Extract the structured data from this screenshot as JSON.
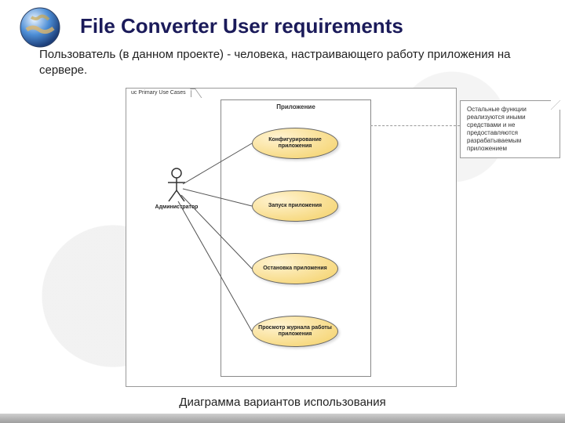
{
  "title": "File Converter User requirements",
  "subtitle": "Пользователь (в данном проекте) - человека, настраивающего работу приложения на сервере.",
  "caption": "Диаграмма вариантов использования",
  "diagram": {
    "frame_label": "uc Primary Use Cases",
    "system_label": "Приложение",
    "actor_label": "Администратор",
    "usecases": [
      "Конфигурирование приложения",
      "Запуск приложения",
      "Остановка приложения",
      "Просмотр журнала работы приложения"
    ],
    "note_text": "Остальные функции реализуются иными средствами и не предоставляются разрабатываемым приложением"
  }
}
